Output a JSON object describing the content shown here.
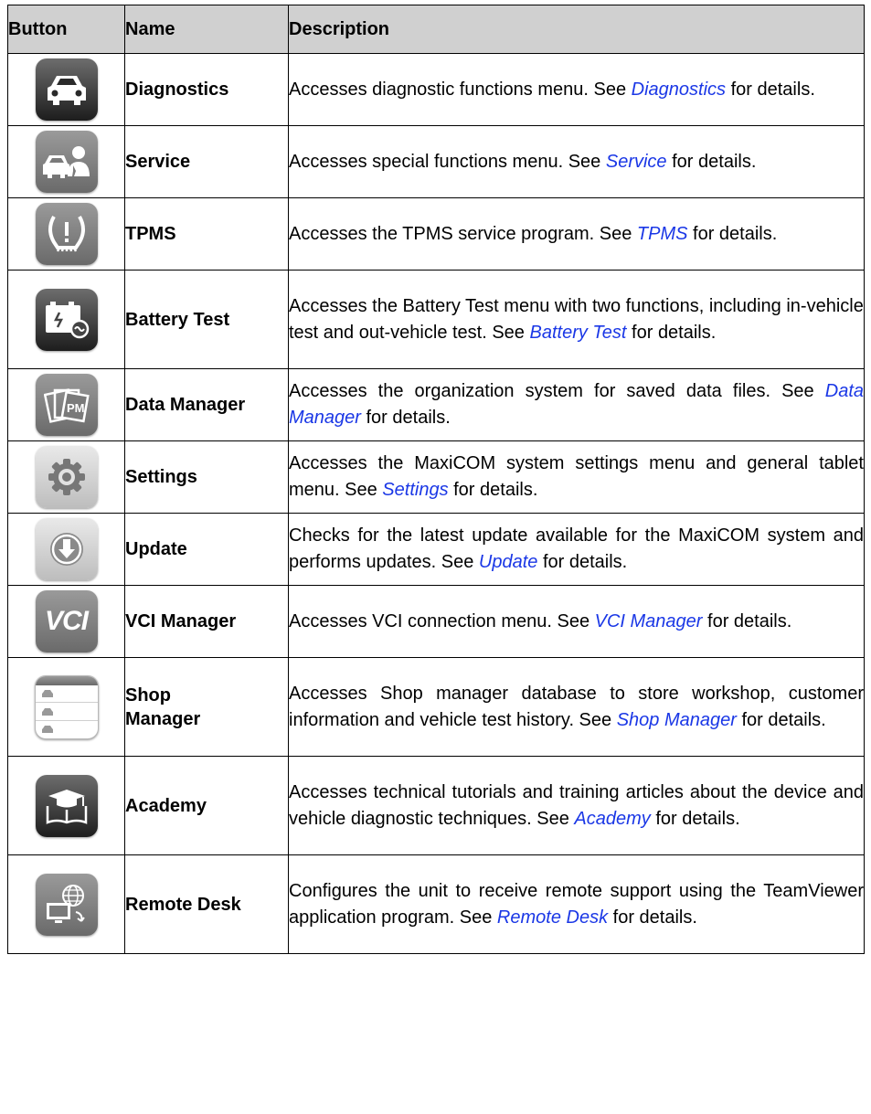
{
  "header": {
    "button": "Button",
    "name": "Name",
    "description": "Description"
  },
  "rows": [
    {
      "name": "Diagnostics",
      "icon": "car-front-icon",
      "before": "Accesses diagnostic functions menu. See ",
      "link": "Diagnostics",
      "after": " for details."
    },
    {
      "name": "Service",
      "icon": "car-mechanic-icon",
      "before": "Accesses special functions menu. See ",
      "link": "Service",
      "after": " for details."
    },
    {
      "name": "TPMS",
      "icon": "tire-pressure-icon",
      "before": "Accesses the TPMS service program. See ",
      "link": "TPMS",
      "after": " for details."
    },
    {
      "name": "Battery Test",
      "icon": "battery-test-icon",
      "before": "Accesses the Battery Test menu with two functions, including in-vehicle test and out-vehicle test. See ",
      "link": "Battery Test",
      "after": " for details."
    },
    {
      "name": "Data Manager",
      "icon": "data-manager-icon",
      "before": "Accesses the organization system for saved data files. See ",
      "link": "Data Manager",
      "after": " for details."
    },
    {
      "name": "Settings",
      "icon": "gear-icon",
      "before": "Accesses the MaxiCOM system settings menu and general tablet menu. See ",
      "link": "Settings",
      "after": " for details."
    },
    {
      "name": "Update",
      "icon": "download-arrow-icon",
      "before": "Checks for the latest update available for the MaxiCOM system and performs updates. See ",
      "link": "Update",
      "after": " for details."
    },
    {
      "name": "VCI Manager",
      "icon": "vci-icon",
      "icon_text": "VCI",
      "before": "Accesses VCI connection menu. See ",
      "link": "VCI Manager",
      "after": " for details."
    },
    {
      "name": "Shop Manager",
      "icon": "shop-manager-icon",
      "before": "Accesses Shop manager database to store workshop, customer information and vehicle test history. See ",
      "link": "Shop Manager",
      "after": " for details."
    },
    {
      "name": "Academy",
      "icon": "academy-book-icon",
      "before": "Accesses technical tutorials and training articles about the device and vehicle diagnostic techniques. See ",
      "link": "Academy",
      "after": " for details."
    },
    {
      "name": "Remote Desk",
      "icon": "remote-desk-icon",
      "before": "Configures the unit to receive remote support using the TeamViewer application program. See ",
      "link": "Remote Desk",
      "after": " for details."
    }
  ],
  "colors": {
    "link": "#1a37e6",
    "header_bg": "#d0d0d0"
  }
}
